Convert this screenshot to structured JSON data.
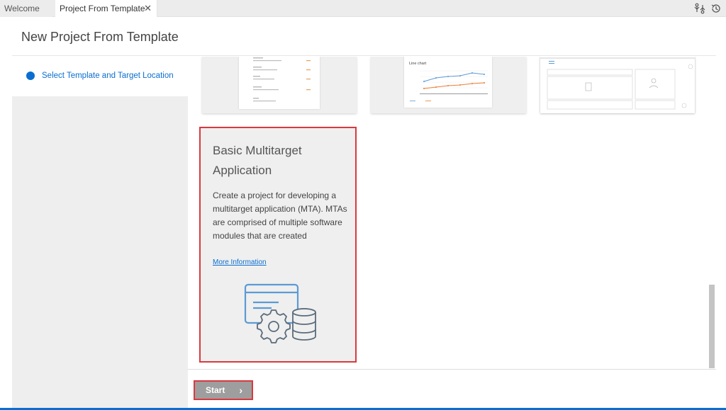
{
  "tabs": {
    "welcome": "Welcome",
    "active": "Project From Template",
    "close_glyph": "✕"
  },
  "toolbar_icons": [
    "compare-changes-icon",
    "history-icon"
  ],
  "page": {
    "title": "New Project From Template"
  },
  "steps": [
    {
      "label": "Select Template and Target Location",
      "state": "current"
    }
  ],
  "preview_cards": [
    {
      "thumbnail_name": "list-report-preview"
    },
    {
      "thumbnail_name": "line-chart-preview",
      "chart_title": "Line chart"
    },
    {
      "thumbnail_name": "form-layout-preview"
    }
  ],
  "selected_template": {
    "title": "Basic Multitarget Application",
    "description": "Create a project for developing a multitarget application (MTA). MTAs are comprised of multiple software modules that are created",
    "link": "More Information",
    "illustration": "mta-illustration-icon"
  },
  "footer": {
    "start_label": "Start",
    "start_chevron": "›"
  },
  "colors": {
    "accent": "#0a6ed1",
    "highlight": "#d9393e",
    "start_button": "#9e9e9e"
  }
}
